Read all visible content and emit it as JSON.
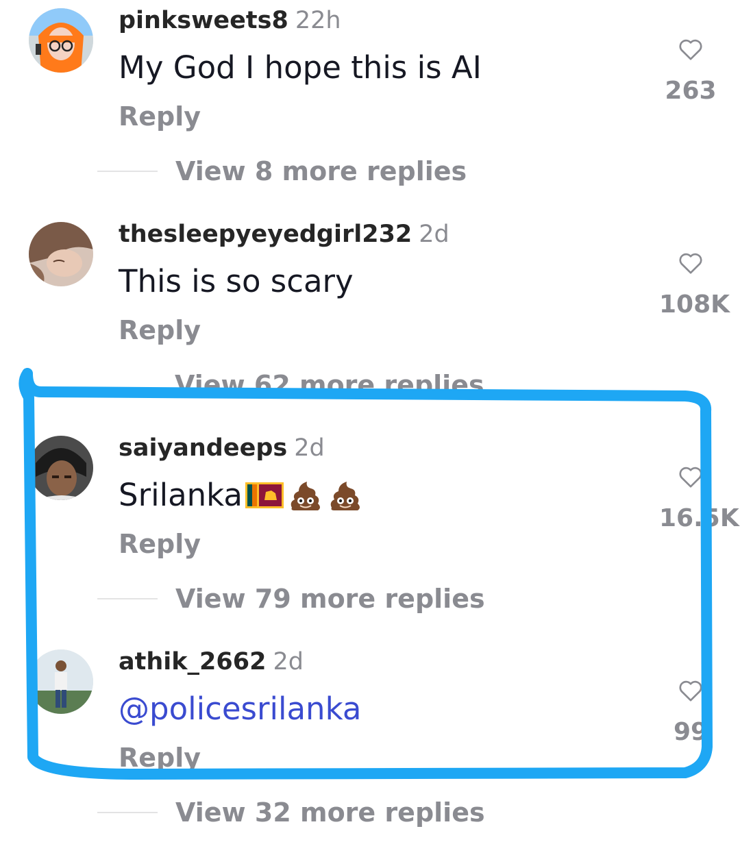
{
  "comments": [
    {
      "username": "pinksweets8",
      "age": "22h",
      "text": "My God I hope this is AI",
      "reply_label": "Reply",
      "likes": "263",
      "view_replies": "View 8 more replies"
    },
    {
      "username": "thesleepyeyedgirl232",
      "age": "2d",
      "text": "This is so scary",
      "reply_label": "Reply",
      "likes": "108K",
      "view_replies": "View 62 more replies"
    },
    {
      "username": "saiyandeeps",
      "age": "2d",
      "text": "Srilanka",
      "emojis": [
        "sri-lanka-flag-icon",
        "pile-of-poo-icon",
        "pile-of-poo-icon"
      ],
      "reply_label": "Reply",
      "likes": "16.5K",
      "view_replies": "View 79 more replies"
    },
    {
      "username": "athik_2662",
      "age": "2d",
      "text": "@policesrilanka",
      "reply_label": "Reply",
      "likes": "99",
      "view_replies": "View 32 more replies"
    }
  ],
  "colors": {
    "muted": "#8a8b91",
    "mention": "#3a4bd0",
    "highlight_stroke": "#1ea7f4"
  }
}
